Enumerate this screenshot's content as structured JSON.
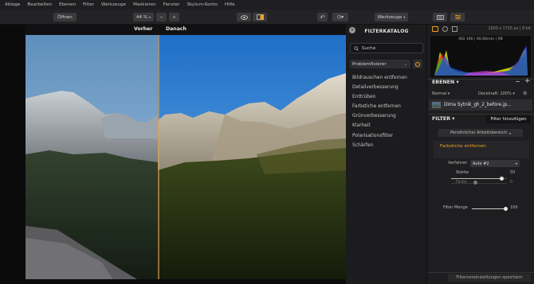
{
  "menu": [
    "Ablage",
    "Bearbeiten",
    "Ebenen",
    "Filter",
    "Werkzeuge",
    "Maskieren",
    "Fenster",
    "Skylum-Konto",
    "Hilfe"
  ],
  "toolbar": {
    "open_label": "Öffnen",
    "zoom_value": "44 %",
    "zoom_out": "−",
    "zoom_in": "+",
    "tools_label": "Werkzeuge"
  },
  "compare": {
    "before_label": "Vorher",
    "after_label": "Danach"
  },
  "catalog": {
    "title": "FILTERKATALOG",
    "search_placeholder": "Suche",
    "category": "Problemfixierer",
    "items": [
      "Bildrauschen entfernen",
      "Detailverbesserung",
      "Enttrüben",
      "Farbstiche entfernen",
      "Grünverbesserung",
      "Klarheit",
      "Polarisationsfilter",
      "Schärfen"
    ]
  },
  "right": {
    "image_size": "2600 x 1735 px | 8-bit",
    "exif": "ISO 100 | 60.00mm | f/8",
    "layers_title": "EBENEN",
    "blend_mode": "Normal",
    "opacity": "Deckkraft: 100%",
    "layer_name": "Dima Sytnik_gh_2_before.jp...",
    "filter_title": "FILTER",
    "add_filter": "Filter hinzufügen",
    "preset_label": "Persönlicher Arbeitsbereich",
    "filter_name": "Farbstiche entfernen",
    "method_label": "Verfahren",
    "method_value": "Auto #2",
    "strength_label": "Stärke",
    "strength_value": "50",
    "color_label": "Farbe",
    "color_value": "0",
    "amount_label": "Filter Menge",
    "amount_value": "100",
    "save_presets": "Filtervoreinstellungen speichern"
  },
  "colors": {
    "accent": "#f0a020",
    "panel": "#1e1e20"
  }
}
